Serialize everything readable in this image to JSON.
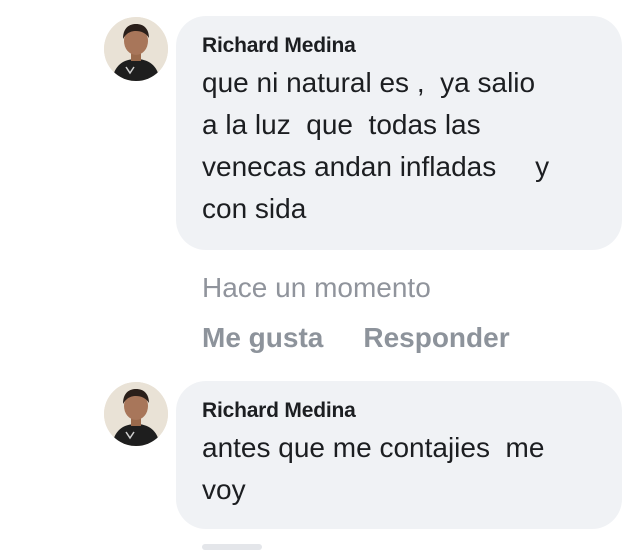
{
  "comments": [
    {
      "author": "Richard Medina",
      "text": "que ni natural es ,  ya salio\na la luz  que  todas las\nvenecas andan infladas     y\ncon sida",
      "timestamp": "Hace un momento",
      "like_label": "Me gusta",
      "reply_label": "Responder",
      "avatar_icon": "profile-photo"
    },
    {
      "author": "Richard Medina",
      "text": "antes que me contajies  me\nvoy",
      "avatar_icon": "profile-photo"
    }
  ],
  "colors": {
    "bubble": "#f0f2f5",
    "meta_text": "#90949c",
    "action_text": "#8d939b",
    "body_text": "#1c1e21"
  }
}
